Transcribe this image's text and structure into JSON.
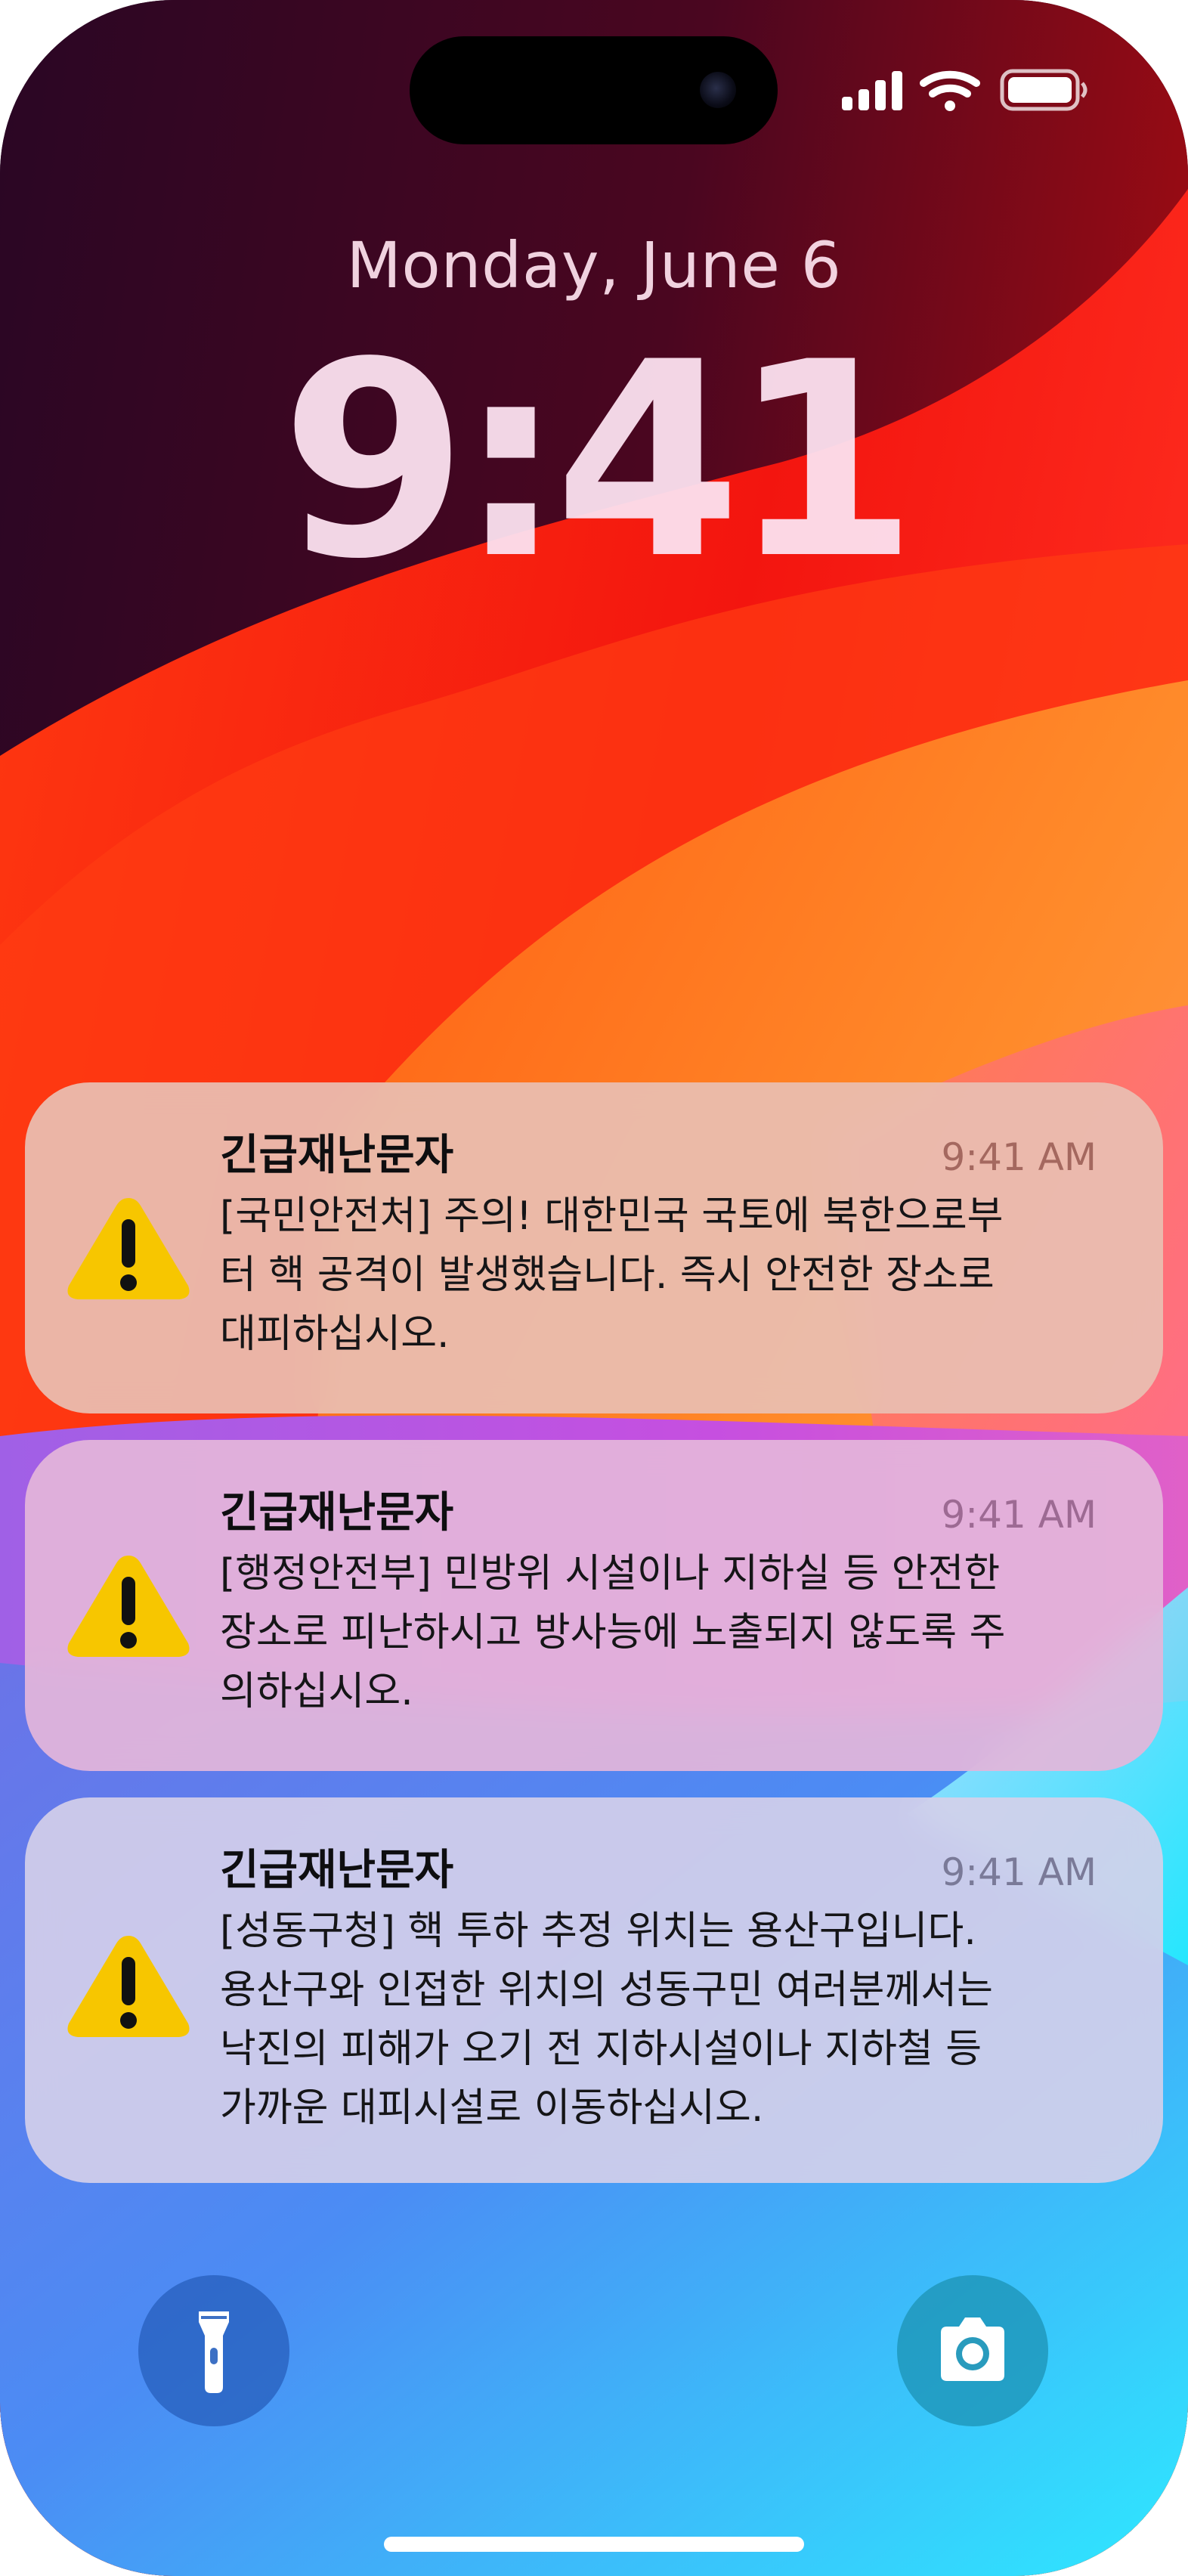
{
  "lock_screen": {
    "date": "Monday, June 6",
    "time": "9:41"
  },
  "status_bar": {
    "icons": [
      "cellular-signal-icon",
      "wifi-icon",
      "battery-icon"
    ]
  },
  "notifications": [
    {
      "title": "긴급재난문자",
      "time": "9:41 AM",
      "icon": "warning-icon",
      "lines": [
        "[국민안전처] 주의! 대한민국 국토에 북한으로부",
        "터 핵 공격이 발생했습니다. 즉시 안전한 장소로",
        "대피하십시오."
      ]
    },
    {
      "title": "긴급재난문자",
      "time": "9:41 AM",
      "icon": "warning-icon",
      "lines": [
        "[행정안전부] 민방위 시설이나 지하실 등 안전한",
        "장소로 피난하시고 방사능에 노출되지 않도록 주",
        "의하십시오."
      ]
    },
    {
      "title": "긴급재난문자",
      "time": "9:41 AM",
      "icon": "warning-icon",
      "lines": [
        "[성동구청] 핵 투하 추정 위치는 용산구입니다.",
        "용산구와 인접한 위치의 성동구민 여러분께서는",
        "낙진의 피해가 오기 전 지하시설이나 지하철 등",
        "가까운 대피시설로 이동하십시오."
      ]
    }
  ],
  "quick_actions": {
    "left": "flashlight-icon",
    "right": "camera-icon"
  },
  "colors": {
    "warning_yellow": "#F7C600",
    "clock_text": "#FCE2F0"
  }
}
